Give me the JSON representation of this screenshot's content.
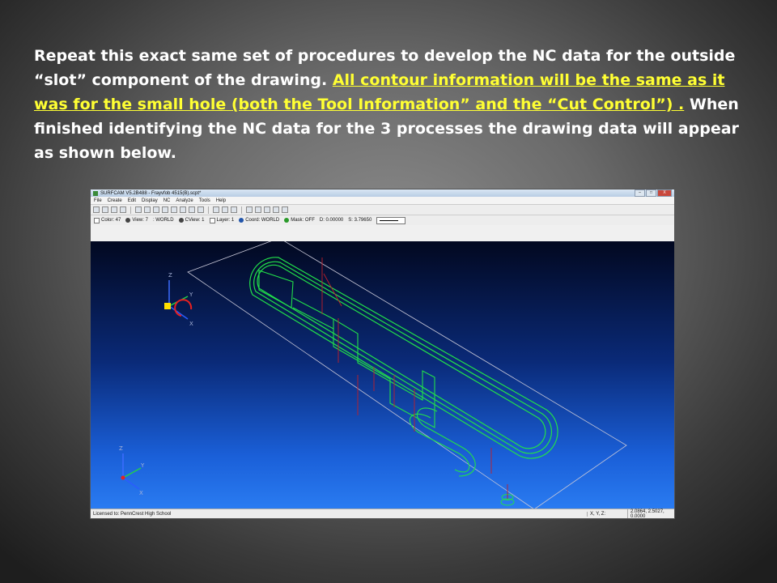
{
  "slide": {
    "text_1": "Repeat this exact same set of procedures to develop the NC data for the outside “slot” component of the drawing. ",
    "text_highlight": "All contour information will be the same as it was for the small hole (both the Tool Information” and the “Cut Control”) .",
    "text_2": " When finished identifying the NC data for the 3 processes the drawing data will appear as shown below."
  },
  "app": {
    "title": "SURFCAM V5.2B488 - Frayvfob 4515(B).scpt*",
    "window_controls": [
      "–",
      "□",
      "X"
    ],
    "menu": [
      "File",
      "Create",
      "Edit",
      "Display",
      "NC",
      "Analyze",
      "Tools",
      "Help"
    ],
    "status": {
      "color": "Color: 47",
      "view": "View: 7",
      "coord_world": ": WORLD",
      "cview": "CView: 1",
      "layer": "Layer: 1",
      "coord": "Coord: WORLD",
      "mask": "Mask: OFF",
      "d": "D: 0.00000",
      "s": "S: 3.79650"
    },
    "license": "Licensed to: PennCrest High School",
    "xyz_label": "X, Y, Z:",
    "coords": "2.0864, 2.5027, 0.0000",
    "axis_labels": {
      "z": "Z",
      "y": "Y",
      "x": "X"
    }
  },
  "colors": {
    "highlight": "#ffff33",
    "contour": "#22e04a",
    "toolpath": "#c0202a"
  }
}
